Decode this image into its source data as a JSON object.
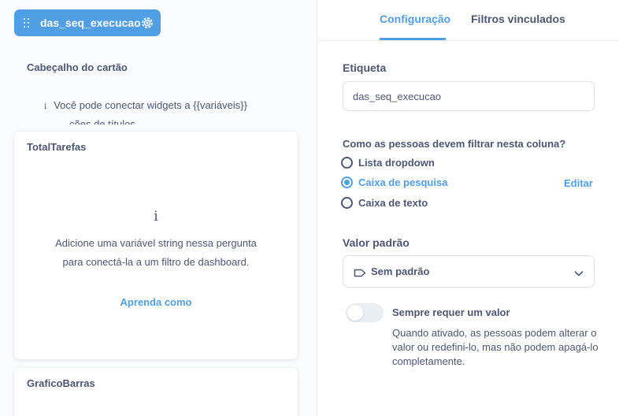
{
  "filter": {
    "name": "das_seq_execucao",
    "icons": {
      "grip": "drag-handle-icon",
      "settings": "gear-icon"
    }
  },
  "left": {
    "card_header_title": "Cabeçalho do cartão",
    "info_text": "Você pode conectar widgets a {{variáveis}}",
    "info_text_cut": "ções de títulos",
    "cards": [
      {
        "title": "TotalTarefas",
        "message": "Adicione uma variável string nessa pergunta para conectá-la a um filtro de dashboard.",
        "link": "Aprenda como"
      },
      {
        "title": "GraficoBarras"
      }
    ]
  },
  "right": {
    "tabs": [
      "Configuração",
      "Filtros vinculados"
    ],
    "active_tab": "Configuração",
    "label_section": "Etiqueta",
    "label_value": "das_seq_execucao",
    "filter_question": "Como as pessoas devem filtrar nesta coluna?",
    "options": [
      "Lista dropdown",
      "Caixa de pesquisa",
      "Caixa de texto"
    ],
    "selected_option": "Caixa de pesquisa",
    "edit_link": "Editar",
    "default_label": "Valor padrão",
    "default_value": "Sem padrão",
    "required_title": "Sempre requer um valor",
    "required_desc": "Quando ativado, as pessoas podem alterar o valor ou redefini-lo, mas não podem apagá-lo completamente.",
    "required_enabled": false
  },
  "colors": {
    "accent": "#509ee3",
    "text": "#4c5773",
    "border": "#e0e2e6"
  }
}
